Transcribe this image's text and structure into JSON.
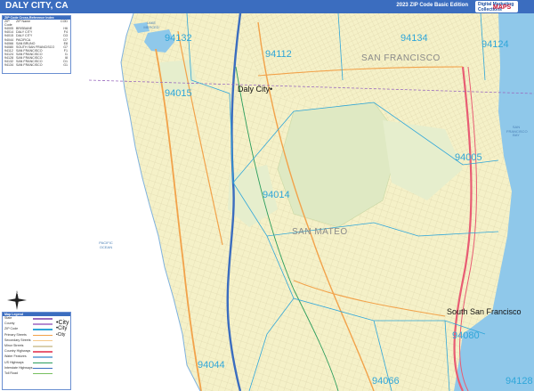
{
  "header": {
    "title": "DALY CITY, CA",
    "edition": "2023 ZIP Code Basic Edition",
    "logo_top": "Digital Marketing Collections",
    "logo_main": "MAPS"
  },
  "zip_table": {
    "heading": "ZIP Code Cross-Reference Index",
    "columns": [
      "ZIP Code",
      "ZIP Name",
      "COD"
    ],
    "rows": [
      [
        "94005",
        "BRISBANE",
        "H6"
      ],
      [
        "94014",
        "DALY CITY",
        "F4"
      ],
      [
        "94015",
        "DALY CITY",
        "D3"
      ],
      [
        "94044",
        "PACIFICA",
        "D7"
      ],
      [
        "94066",
        "SAN BRUNO",
        "E8"
      ],
      [
        "94080",
        "SOUTH SAN FRANCISCO",
        "G7"
      ],
      [
        "94112",
        "SAN FRANCISCO",
        "F1"
      ],
      [
        "94124",
        "SAN FRANCISCO",
        "I1"
      ],
      [
        "94128",
        "SAN FRANCISCO",
        "I8"
      ],
      [
        "94132",
        "SAN FRANCISCO",
        "D1"
      ],
      [
        "94134",
        "SAN FRANCISCO",
        "G1"
      ]
    ]
  },
  "map_key": {
    "heading": "Map Legend",
    "items": [
      {
        "label": "State",
        "color": "#9a6bbf"
      },
      {
        "label": "County",
        "color": "#b58ad1"
      },
      {
        "label": "ZIP Code",
        "color": "#2fa6d9"
      },
      {
        "label": "Primary Streets",
        "color": "#f2a24a"
      },
      {
        "label": "Secondary Streets",
        "color": "#f4c98a"
      },
      {
        "label": "Minor Streets",
        "color": "#d9cfae"
      },
      {
        "label": "Country Highways",
        "color": "#e85c73"
      },
      {
        "label": "Water Features",
        "color": "#7fb2de"
      },
      {
        "label": "US Highways",
        "color": "#2a9d5c"
      },
      {
        "label": "Interstate Highways",
        "color": "#3b6dbf"
      },
      {
        "label": "Toll Road",
        "color": "#77c060"
      }
    ],
    "city_samples": [
      "•City",
      "•City",
      "•City"
    ]
  },
  "map": {
    "zip_labels": [
      {
        "text": "94132"
      },
      {
        "text": "94112"
      },
      {
        "text": "94134"
      },
      {
        "text": "94124"
      },
      {
        "text": "94015"
      },
      {
        "text": "94005"
      },
      {
        "text": "94014"
      },
      {
        "text": "94080"
      },
      {
        "text": "94044"
      },
      {
        "text": "94066"
      },
      {
        "text": "94128"
      }
    ],
    "area_labels": [
      "SAN FRANCISCO",
      "SAN MATEO"
    ],
    "cities": [
      "Daly City•",
      "South San Francisco"
    ],
    "water_labels": [
      "LAKE MERCED",
      "PACIFIC OCEAN",
      "SAN FRANCISCO BAY"
    ]
  },
  "colors": {
    "land": "#f5f1c8",
    "park": "#dfe9c3",
    "water": "#8fc8ea",
    "zip_boundary": "#2fa6d9",
    "header": "#3b6dbf"
  }
}
